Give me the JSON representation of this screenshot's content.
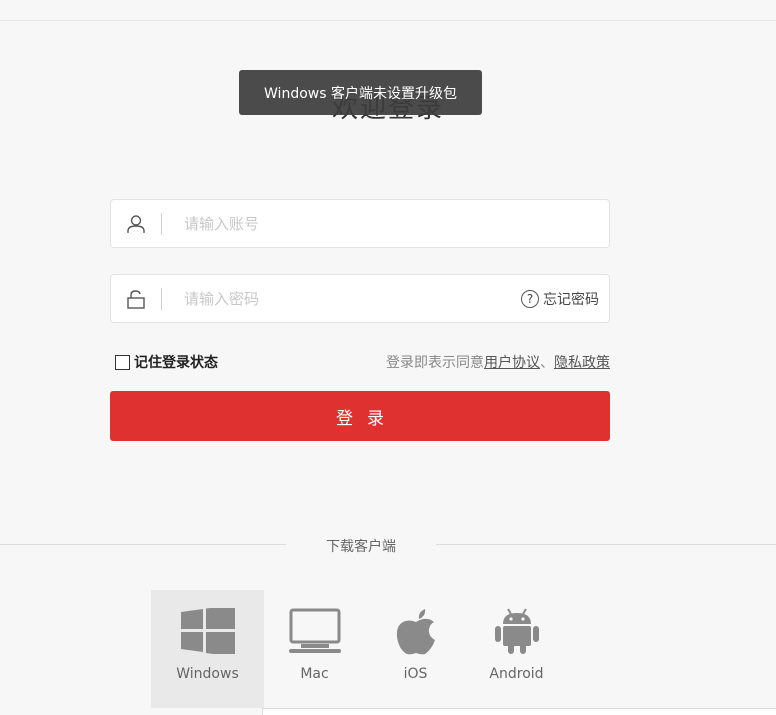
{
  "page": {
    "title": "欢迎登录",
    "toast": "Windows 客户端未设置升级包"
  },
  "form": {
    "account_placeholder": "请输入账号",
    "password_placeholder": "请输入密码",
    "forgot_label": "忘记密码",
    "remember_label": "记住登录状态",
    "agree_prefix": "登录即表示同意",
    "user_agreement": "用户协议",
    "separator": "、",
    "privacy_policy": "隐私政策",
    "login_label": "登录"
  },
  "download": {
    "title": "下载客户端",
    "clients": [
      {
        "label": "Windows",
        "icon": "windows-icon",
        "selected": true
      },
      {
        "label": "Mac",
        "icon": "monitor-icon",
        "selected": false
      },
      {
        "label": "iOS",
        "icon": "apple-icon",
        "selected": false
      },
      {
        "label": "Android",
        "icon": "android-icon",
        "selected": false
      }
    ]
  },
  "colors": {
    "accent": "#e03131",
    "icon_gray": "#888888"
  }
}
